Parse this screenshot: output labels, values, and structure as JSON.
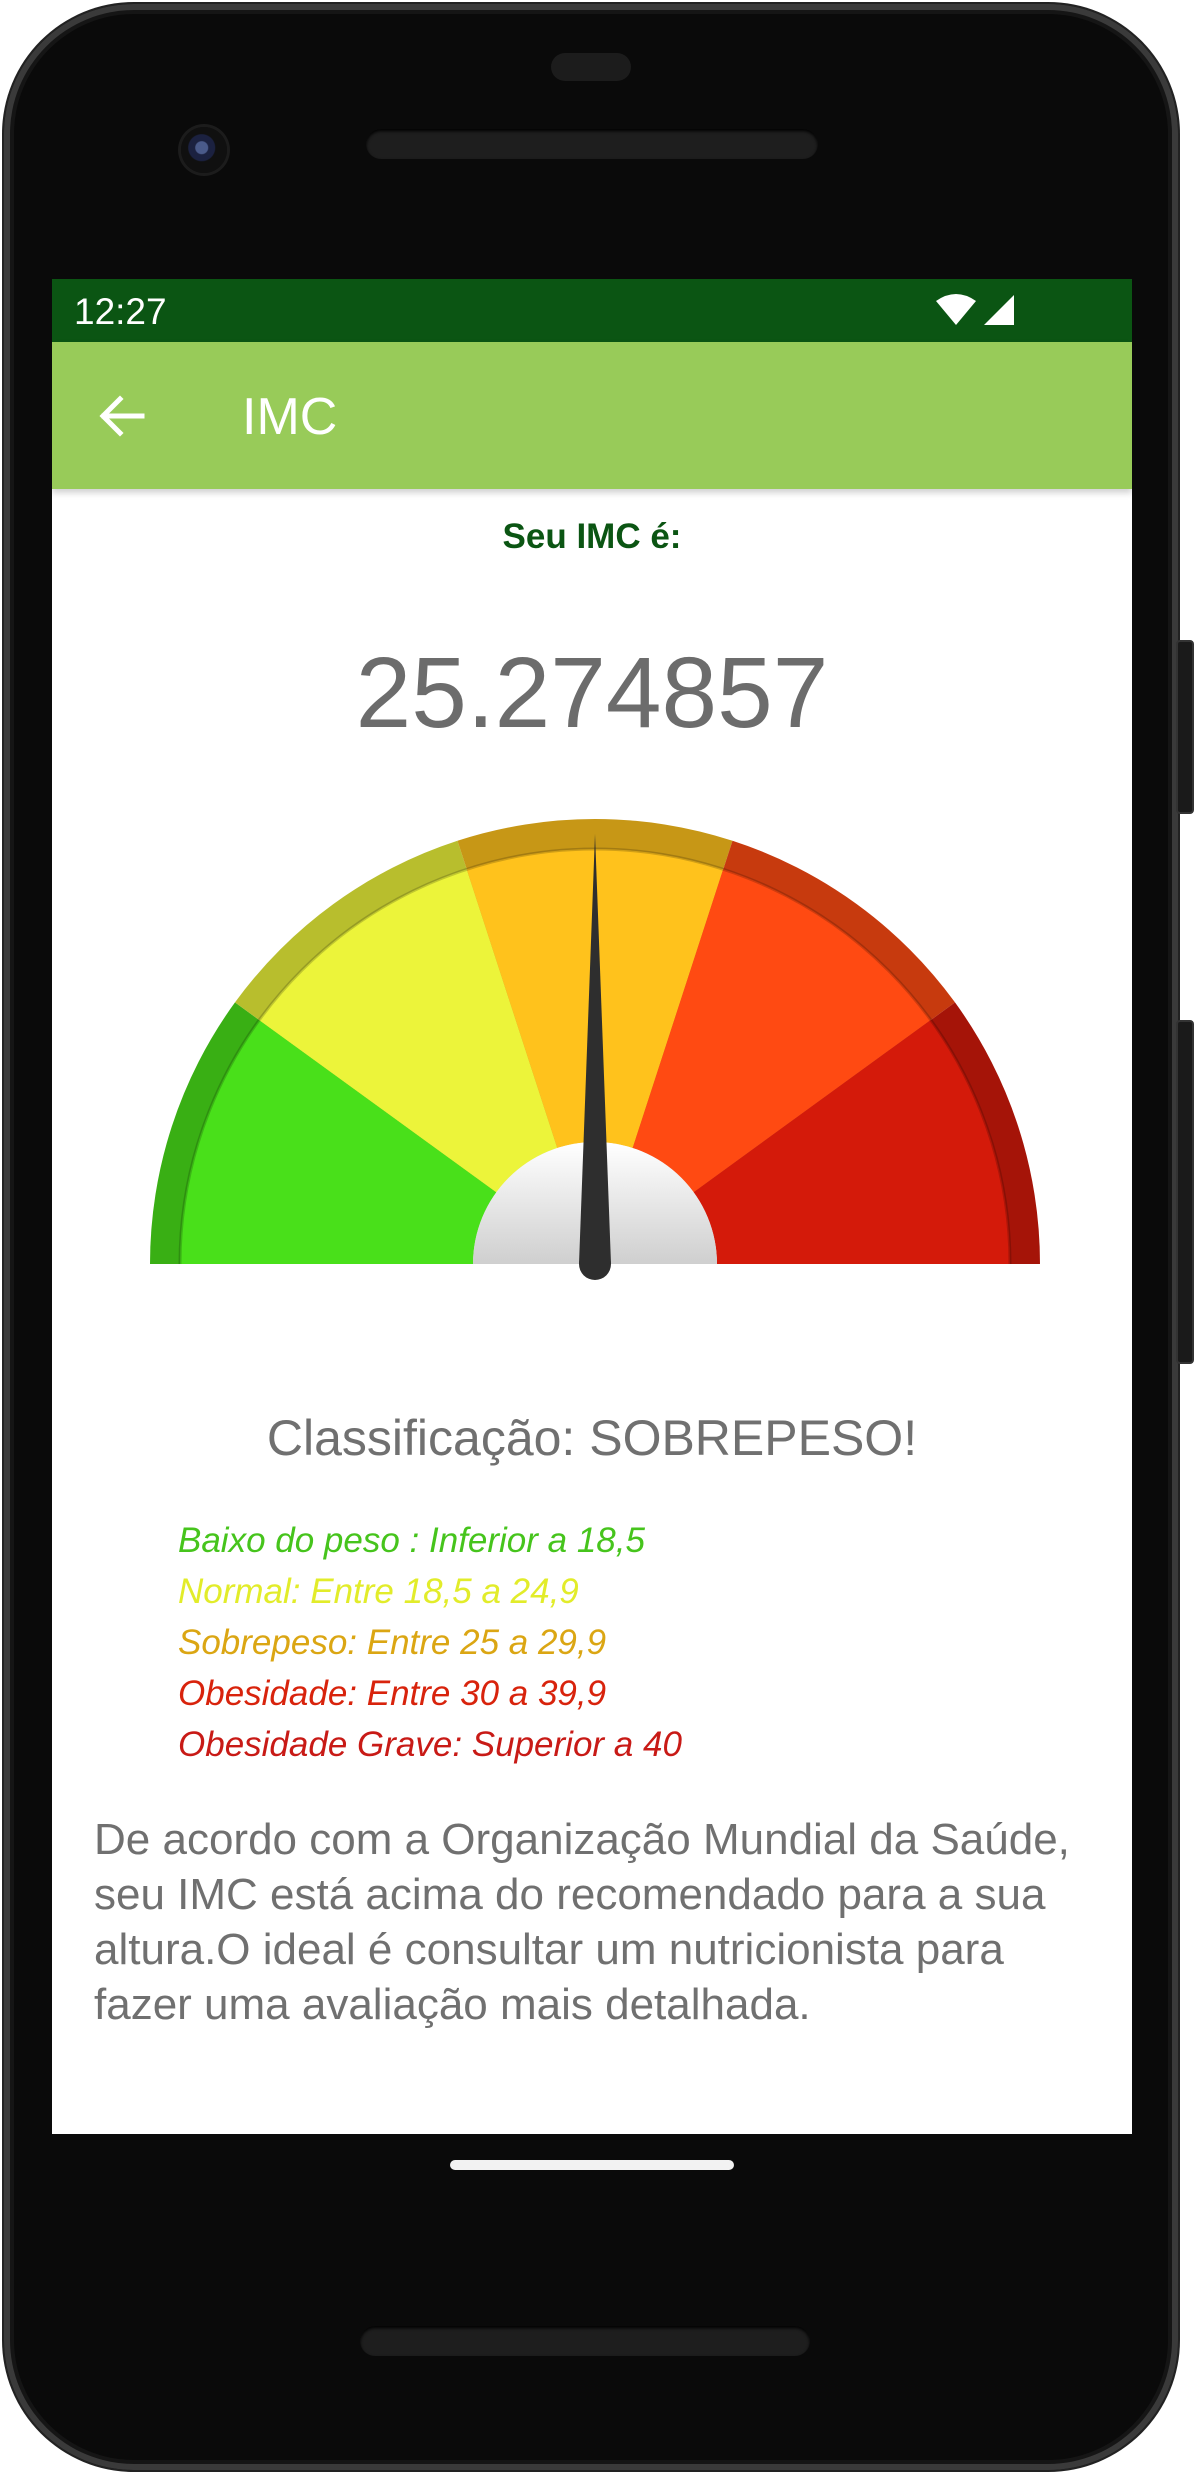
{
  "status_bar": {
    "time": "12:27",
    "icons": [
      "wifi-icon",
      "signal-icon"
    ],
    "background": "#0b5513"
  },
  "app_bar": {
    "title": "IMC",
    "back_icon": "arrow-back-icon",
    "background": "#98cb59"
  },
  "result": {
    "label": "Seu IMC é:",
    "value": "25.274857",
    "classification": "Classificação: SOBREPESO!"
  },
  "gauge": {
    "segments": [
      {
        "name": "baixo-peso",
        "color": "#49e01a"
      },
      {
        "name": "normal",
        "color": "#ecf43a"
      },
      {
        "name": "sobrepeso",
        "color": "#ffc21c"
      },
      {
        "name": "obesidade",
        "color": "#ff4a12"
      },
      {
        "name": "obesidade-grave",
        "color": "#d41a0a"
      }
    ],
    "needle_fraction": 0.5
  },
  "ranges": [
    {
      "text": "Baixo do peso : Inferior a 18,5",
      "color": "#46c41c"
    },
    {
      "text": "Normal: Entre 18,5 a 24,9",
      "color": "#e2ec2a"
    },
    {
      "text": "Sobrepeso: Entre 25 a 29,9",
      "color": "#dba613"
    },
    {
      "text": "Obesidade: Entre 30 a 39,9",
      "color": "#d8230c"
    },
    {
      "text": "Obesidade Grave: Superior a 40",
      "color": "#c81a16"
    }
  ],
  "description": "De acordo com a Organização Mundial da Saúde, seu IMC está acima do recomendado para a sua altura.O ideal é consultar um nutricionista para fazer uma avaliação mais detalhada."
}
